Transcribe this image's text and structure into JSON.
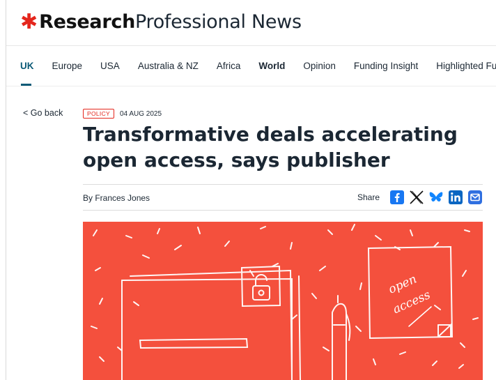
{
  "logo": {
    "bold": "Research",
    "light": "Professional News"
  },
  "nav": {
    "items": [
      {
        "label": "UK"
      },
      {
        "label": "Europe"
      },
      {
        "label": "USA"
      },
      {
        "label": "Australia & NZ"
      },
      {
        "label": "Africa"
      },
      {
        "label": "World"
      },
      {
        "label": "Opinion"
      },
      {
        "label": "Funding Insight"
      },
      {
        "label": "Highlighted Funding Op"
      }
    ]
  },
  "back": {
    "label": "< Go back"
  },
  "article": {
    "tag": "POLICY",
    "date": "04 AUG 2025",
    "title": "Transformative deals accelerating open access, says publisher",
    "byline": "By Frances Jones",
    "share_label": "Share"
  },
  "hero": {
    "note_text_1": "open",
    "note_text_2": "access"
  },
  "colors": {
    "brand_red": "#e4261c",
    "nav_active": "#0c5a77",
    "hero_bg": "#f4503d"
  },
  "share_icons": [
    "facebook-icon",
    "x-icon",
    "bluesky-icon",
    "linkedin-icon",
    "email-icon"
  ]
}
